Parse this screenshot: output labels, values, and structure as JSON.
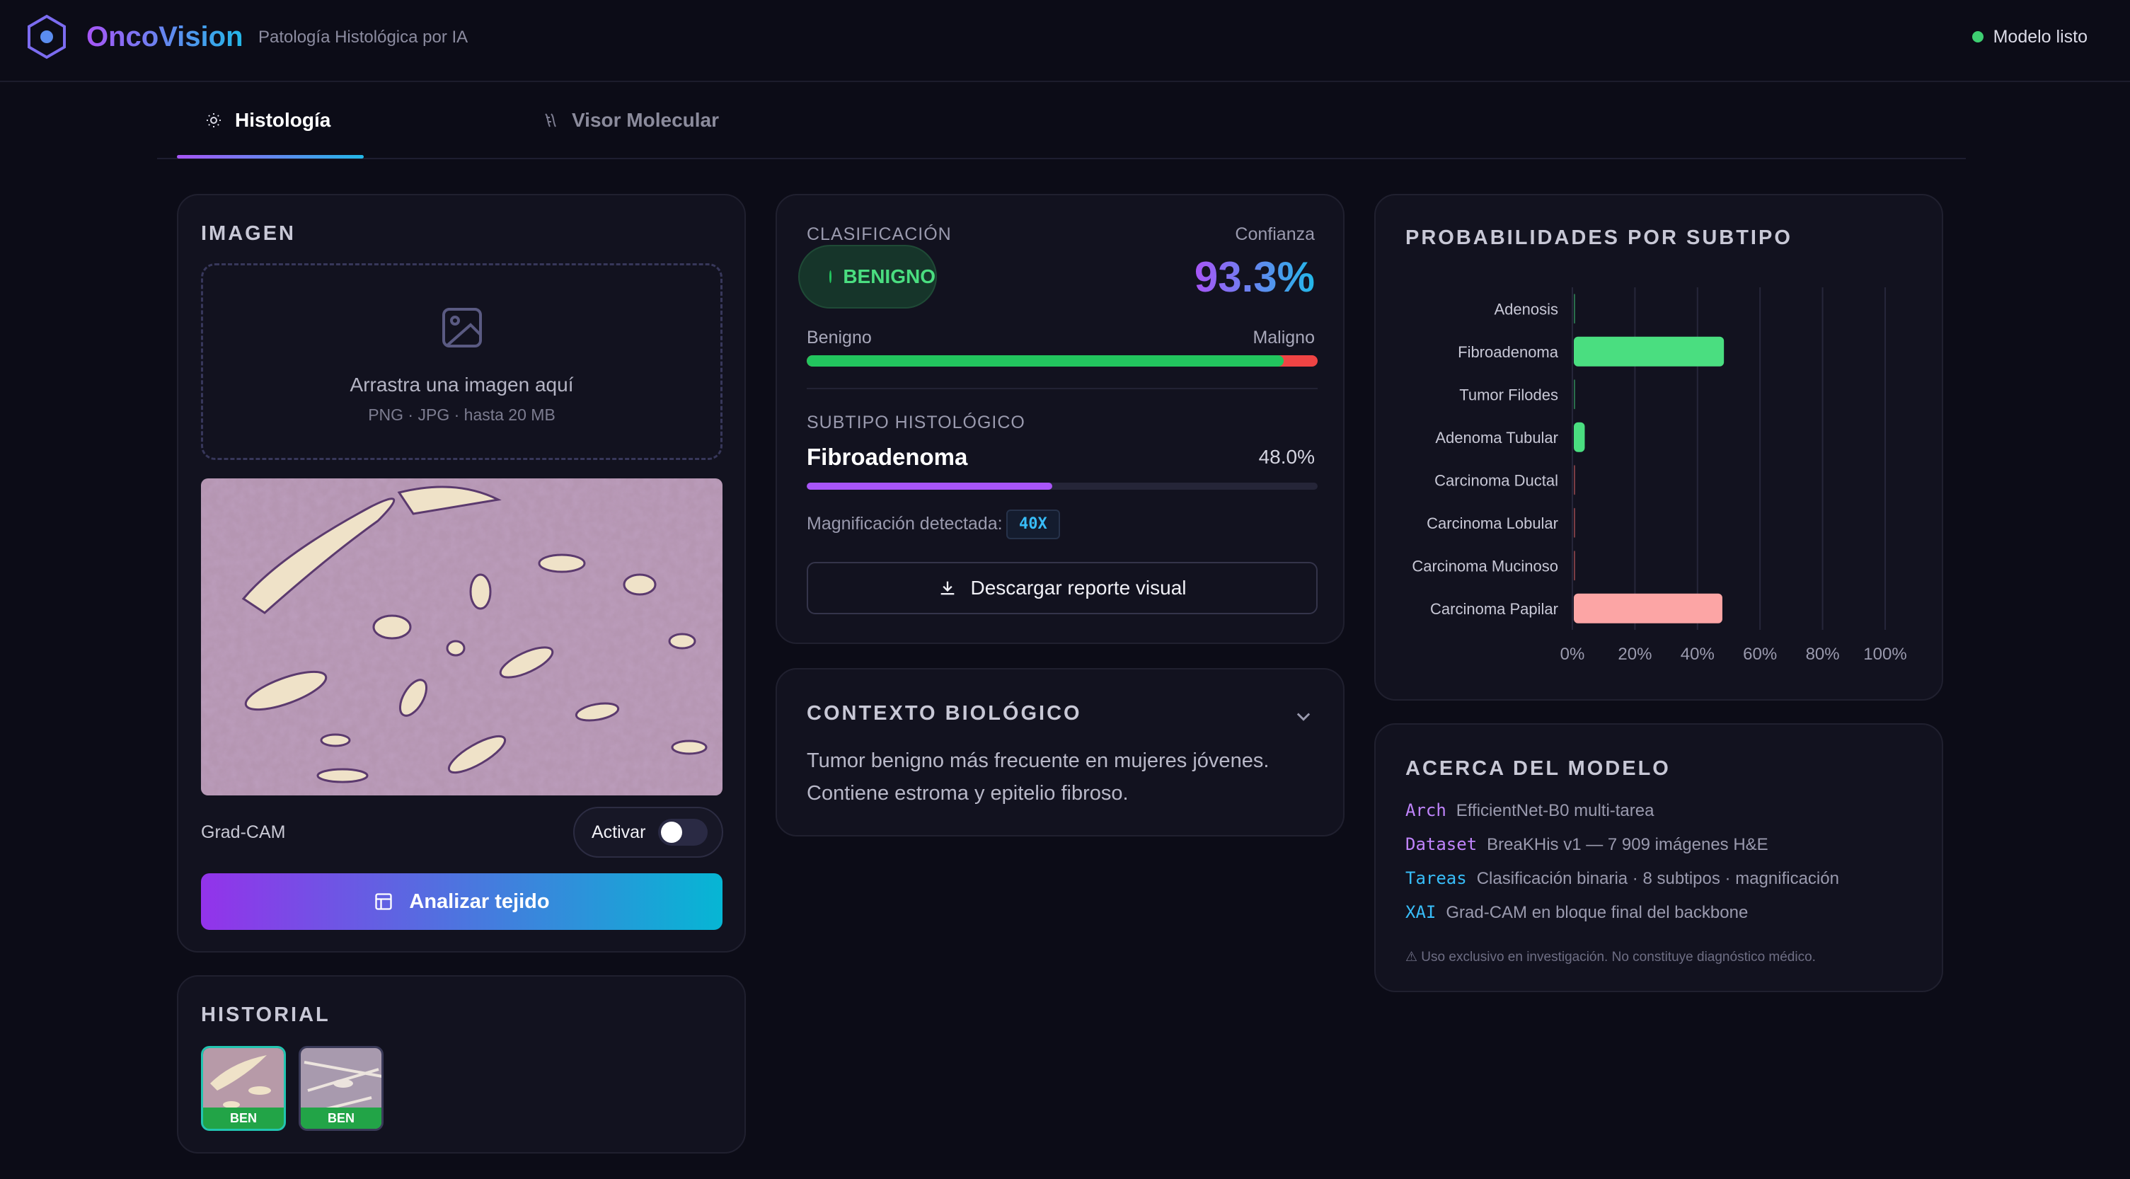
{
  "header": {
    "brand": "OncoVision",
    "subtitle": "Patología Histológica por IA",
    "status": "Modelo listo",
    "status_color": "#3ecf72"
  },
  "tabs": [
    {
      "label": "Histología",
      "icon": "sun-icon",
      "active": true
    },
    {
      "label": "Visor Molecular",
      "icon": "molecule-icon",
      "active": false
    }
  ],
  "image_panel": {
    "title": "IMAGEN",
    "drop_text": "Arrastra una imagen aquí",
    "drop_sub": "PNG · JPG · hasta 20 MB",
    "gradcam_label": "Grad-CAM",
    "toggle_label": "Activar",
    "toggle_on": false,
    "analyze_button": "Analizar tejido"
  },
  "history": {
    "title": "HISTORIAL",
    "items": [
      {
        "tag": "BEN",
        "selected": true
      },
      {
        "tag": "BEN",
        "selected": false
      }
    ]
  },
  "classification": {
    "label": "CLASIFICACIÓN",
    "result": "BENIGNO",
    "confidence_label": "Confianza",
    "confidence": "93.3%",
    "benign_label": "Benigno",
    "malign_label": "Maligno",
    "benign_fraction": 0.933,
    "subtype_label": "SUBTIPO HISTOLÓGICO",
    "subtype": "Fibroadenoma",
    "subtype_value": "48.0%",
    "subtype_fraction": 0.48,
    "magnification_label": "Magnificación detectada:",
    "magnification": "40X",
    "download_button": "Descargar reporte visual"
  },
  "context": {
    "title": "CONTEXTO BIOLÓGICO",
    "text": "Tumor benigno más frecuente en mujeres jóvenes. Contiene estroma y epitelio fibroso."
  },
  "about": {
    "title": "ACERCA DEL MODELO",
    "rows": [
      {
        "key": "Arch",
        "value": "EfficientNet-B0 multi-tarea",
        "color": "#c084fc"
      },
      {
        "key": "Dataset",
        "value": "BreaKHis v1 — 7 909 imágenes H&E",
        "color": "#c084fc"
      },
      {
        "key": "Tareas",
        "value": "Clasificación binaria · 8 subtipos · magnificación",
        "color": "#38bdf8"
      },
      {
        "key": "XAI",
        "value": "Grad-CAM en bloque final del backbone",
        "color": "#38bdf8"
      }
    ],
    "note": "⚠ Uso exclusivo en investigación. No constituye diagnóstico médico."
  },
  "chart_data": {
    "type": "bar",
    "orientation": "horizontal",
    "title": "PROBABILIDADES POR SUBTIPO",
    "categories": [
      "Adenosis",
      "Fibroadenoma",
      "Tumor Filodes",
      "Adenoma Tubular",
      "Carcinoma Ductal",
      "Carcinoma Lobular",
      "Carcinoma Mucinoso",
      "Carcinoma Papilar"
    ],
    "values": [
      0,
      48.0,
      0.3,
      3.5,
      0.2,
      0.2,
      0.1,
      47.5
    ],
    "colors": [
      "#4ade80",
      "#4ade80",
      "#4ade80",
      "#4ade80",
      "#f87171",
      "#f87171",
      "#f87171",
      "#fca5a5"
    ],
    "xlim": [
      0,
      100
    ],
    "xticks": [
      "0%",
      "20%",
      "40%",
      "60%",
      "80%",
      "100%"
    ],
    "grid": true
  }
}
